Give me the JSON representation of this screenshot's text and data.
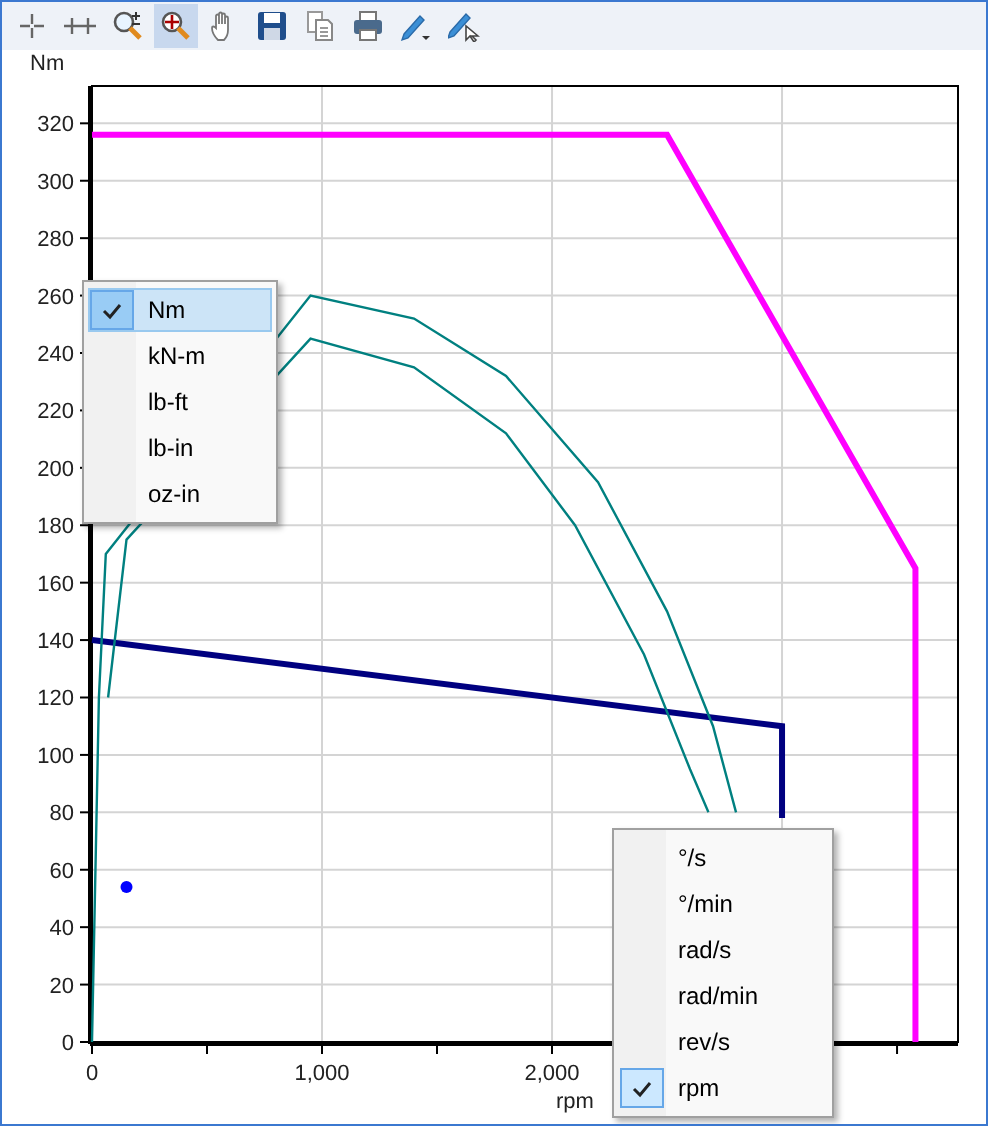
{
  "toolbar": [
    {
      "selected": false
    },
    {
      "selected": false
    },
    {
      "selected": false
    },
    {
      "selected": true
    },
    {
      "selected": false
    },
    {
      "selected": false
    },
    {
      "selected": false
    },
    {
      "selected": false
    },
    {
      "selected": false
    },
    {
      "selected": false
    }
  ],
  "chart": {
    "chart_data": {
      "type": "line",
      "ylabel": "Nm",
      "xlabel": "rpm",
      "xlim": [
        0,
        3765
      ],
      "ylim": [
        0,
        333
      ],
      "xticks": [
        0,
        {
          "value": 1000,
          "label": "1,000"
        },
        {
          "value": 2000,
          "label": "2,000"
        }
      ],
      "yticks": [
        0,
        20,
        40,
        60,
        80,
        100,
        120,
        140,
        160,
        180,
        200,
        220,
        240,
        260,
        280,
        300,
        320
      ],
      "series": [
        {
          "color": "#ff00ff",
          "x": [
            0,
            2500,
            3580,
            3580
          ],
          "values": [
            316,
            316,
            165,
            0
          ]
        },
        {
          "color": "#000080",
          "x": [
            0,
            3000,
            3000
          ],
          "values": [
            140,
            110,
            78
          ]
        },
        {
          "color": "#008080",
          "x": [
            0,
            30,
            60,
            950,
            1400,
            1800,
            2200,
            2500,
            2700,
            2800
          ],
          "values": [
            0,
            120,
            170,
            260,
            252,
            232,
            195,
            150,
            110,
            80
          ]
        },
        {
          "color": "#008080",
          "x": [
            70,
            150,
            950,
            1400,
            1800,
            2100,
            2400,
            2600,
            2680
          ],
          "values": [
            120,
            175,
            245,
            235,
            212,
            180,
            135,
            95,
            80
          ]
        },
        {
          "color": "#0000ff",
          "x": [
            150
          ],
          "values": [
            54
          ],
          "marker": true
        }
      ],
      "grid": true
    }
  },
  "menus": [
    {
      "items": [
        {
          "label": "Nm",
          "checked": true,
          "hovered": true
        },
        {
          "label": "kN-m",
          "checked": false,
          "hovered": false
        },
        {
          "label": "lb-ft",
          "checked": false,
          "hovered": false
        },
        {
          "label": "lb-in",
          "checked": false,
          "hovered": false
        },
        {
          "label": "oz-in",
          "checked": false,
          "hovered": false
        }
      ]
    },
    {
      "items": [
        {
          "label": "°/s",
          "checked": false,
          "hovered": false
        },
        {
          "label": "°/min",
          "checked": false,
          "hovered": false
        },
        {
          "label": "rad/s",
          "checked": false,
          "hovered": false
        },
        {
          "label": "rad/min",
          "checked": false,
          "hovered": false
        },
        {
          "label": "rev/s",
          "checked": false,
          "hovered": false
        },
        {
          "label": "rpm",
          "checked": true,
          "hovered": false
        }
      ]
    }
  ]
}
